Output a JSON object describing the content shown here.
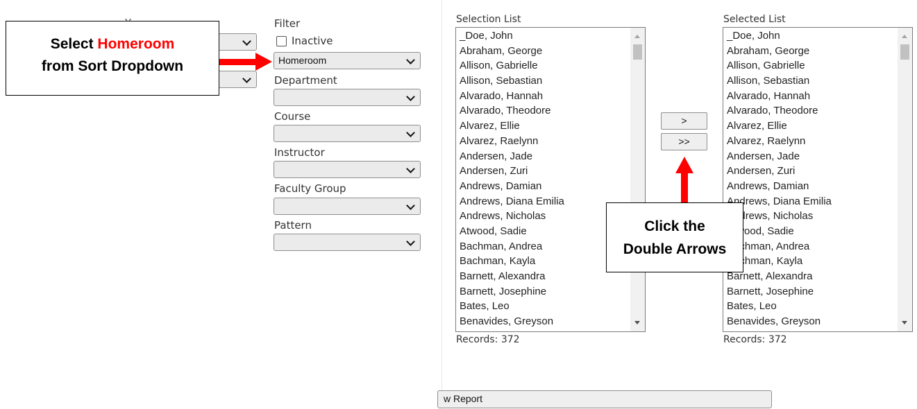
{
  "left_selects": {
    "peek_label": "Y"
  },
  "filter": {
    "title": "Filter",
    "inactive_label": "Inactive",
    "inactive_checked": false,
    "sort_value": "Homeroom",
    "department_label": "Department",
    "course_label": "Course",
    "instructor_label": "Instructor",
    "faculty_group_label": "Faculty Group",
    "pattern_label": "Pattern"
  },
  "selection_list": {
    "title": "Selection List",
    "records": "Records: 372",
    "items": [
      "_Doe, John",
      "Abraham, George",
      "Allison, Gabrielle",
      "Allison, Sebastian",
      "Alvarado, Hannah",
      "Alvarado, Theodore",
      "Alvarez, Ellie",
      "Alvarez, Raelynn",
      "Andersen, Jade",
      "Andersen, Zuri",
      "Andrews, Damian",
      "Andrews, Diana Emilia",
      "Andrews, Nicholas",
      "Atwood, Sadie",
      "Bachman, Andrea",
      "Bachman, Kayla",
      "Barnett, Alexandra",
      "Barnett, Josephine",
      "Bates, Leo",
      "Benavides, Greyson"
    ]
  },
  "selected_list": {
    "title": "Selected List",
    "records": "Records: 372",
    "items": [
      "_Doe, John",
      "Abraham, George",
      "Allison, Gabrielle",
      "Allison, Sebastian",
      "Alvarado, Hannah",
      "Alvarado, Theodore",
      "Alvarez, Ellie",
      "Alvarez, Raelynn",
      "Andersen, Jade",
      "Andersen, Zuri",
      "Andrews, Damian",
      "Andrews, Diana Emilia",
      "Andrews, Nicholas",
      "Atwood, Sadie",
      "Bachman, Andrea",
      "Bachman, Kayla",
      "Barnett, Alexandra",
      "Barnett, Josephine",
      "Bates, Leo",
      "Benavides, Greyson"
    ]
  },
  "buttons": {
    "move_one": ">",
    "move_all": ">>",
    "report": "w Report"
  },
  "callouts": {
    "sort": {
      "line1_prefix": "Select ",
      "line1_highlight": "Homeroom",
      "line2": "from Sort Dropdown"
    },
    "arrows": {
      "line1": "Click the",
      "line2": "Double Arrows"
    }
  },
  "colors": {
    "annotation_red": "#ff0000"
  }
}
